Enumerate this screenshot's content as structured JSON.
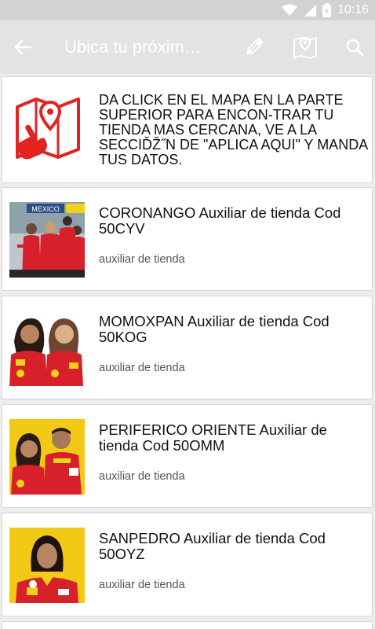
{
  "status_bar": {
    "time": "10:16",
    "icons": [
      "wifi-icon",
      "signal-icon",
      "battery-icon"
    ]
  },
  "app_bar": {
    "title": "Ubica tu próxim…",
    "icons": [
      "back-arrow-icon",
      "edit-pencil-icon",
      "map-marker-icon",
      "search-icon"
    ]
  },
  "intro_card": {
    "icon": "map-tap-icon",
    "text": "DA CLICK EN EL MAPA  EN LA PARTE SUPERIOR PARA ENCON-TRAR TU TIENDA MAS CERCANA, VE A LA  SECCIďž˝N DE \"APLICA AQUI\" Y MANDA TUS DATOS."
  },
  "jobs": [
    {
      "title": "CORONANGO Auxiliar de tienda Cod 50CYV",
      "subtitle": "auxiliar de tienda",
      "photo_text": "MEXICO"
    },
    {
      "title": "MOMOXPAN Auxiliar de tienda Cod 50KOG",
      "subtitle": "auxiliar de tienda"
    },
    {
      "title": "PERIFERICO ORIENTE Auxiliar de tienda Cod 50OMM",
      "subtitle": "auxiliar de tienda"
    },
    {
      "title": "SANPEDRO Auxiliar de tienda Cod 50OYZ",
      "subtitle": "auxiliar de tienda"
    }
  ],
  "colors": {
    "accent_red": "#e32222",
    "uniform_red": "#d8202a",
    "yellow_bg": "#f2c914"
  }
}
